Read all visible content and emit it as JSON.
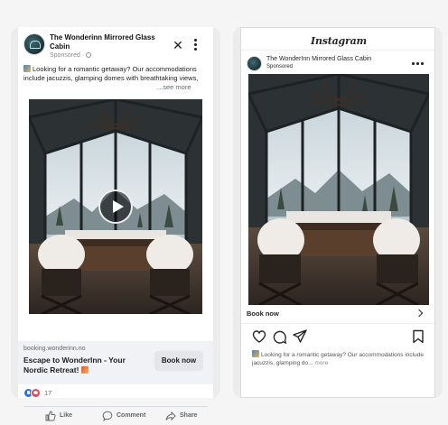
{
  "facebook": {
    "page_name": "The Wonderinn Mirrored Glass Cabin",
    "sponsored": "Sponsored · ",
    "primary_text": "Looking for a romantic getaway? Our accommodations include jacuzzis, glamping domes with breathtaking views,",
    "see_more": "...see more",
    "link_domain": "booking.wonderinn.no",
    "link_headline": "Escape to WonderInn - Your Nordic Retreat!",
    "cta_label": "Book now",
    "reaction_count": "17",
    "actions": {
      "like": "Like",
      "comment": "Comment",
      "share": "Share"
    }
  },
  "instagram": {
    "logo": "Instagram",
    "account_name": "The WonderInn Mirrored Glass Cabin",
    "sponsored": "Sponsored",
    "cta_label": "Book now",
    "caption": "Looking for a romantic getaway? Our accommodations include jacuzzis, glamping do...",
    "more": "more"
  },
  "colors": {
    "fb_blue": "#1877f2",
    "love_red": "#f33e58",
    "link_box_bg": "#f0f2f5",
    "cta_bg": "#e4e6eb"
  }
}
